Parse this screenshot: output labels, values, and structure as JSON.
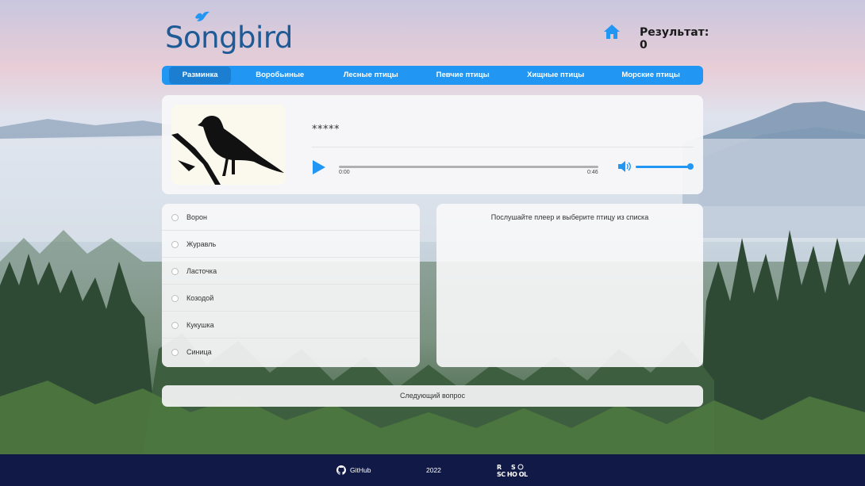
{
  "header": {
    "logo_text": "Songbird",
    "score_label": "Результат: 0"
  },
  "nav": {
    "items": [
      {
        "label": "Разминка",
        "active": true
      },
      {
        "label": "Воробьиные",
        "active": false
      },
      {
        "label": "Лесные птицы",
        "active": false
      },
      {
        "label": "Певчие птицы",
        "active": false
      },
      {
        "label": "Хищные птицы",
        "active": false
      },
      {
        "label": "Морские птицы",
        "active": false
      }
    ]
  },
  "player": {
    "hidden_name": "*****",
    "current_time": "0:00",
    "duration": "0:46",
    "progress": 0,
    "volume": 1
  },
  "options": [
    {
      "label": "Ворон"
    },
    {
      "label": "Журавль"
    },
    {
      "label": "Ласточка"
    },
    {
      "label": "Козодой"
    },
    {
      "label": "Кукушка"
    },
    {
      "label": "Синица"
    }
  ],
  "info": {
    "prompt": "Послушайте плеер и выберите птицу из списка"
  },
  "next_button": {
    "label": "Следующий вопрос"
  },
  "footer": {
    "github_label": "GitHub",
    "year": "2022"
  },
  "colors": {
    "accent": "#2196f3",
    "logo": "#1d5a96",
    "footer_bg": "#111a47"
  }
}
